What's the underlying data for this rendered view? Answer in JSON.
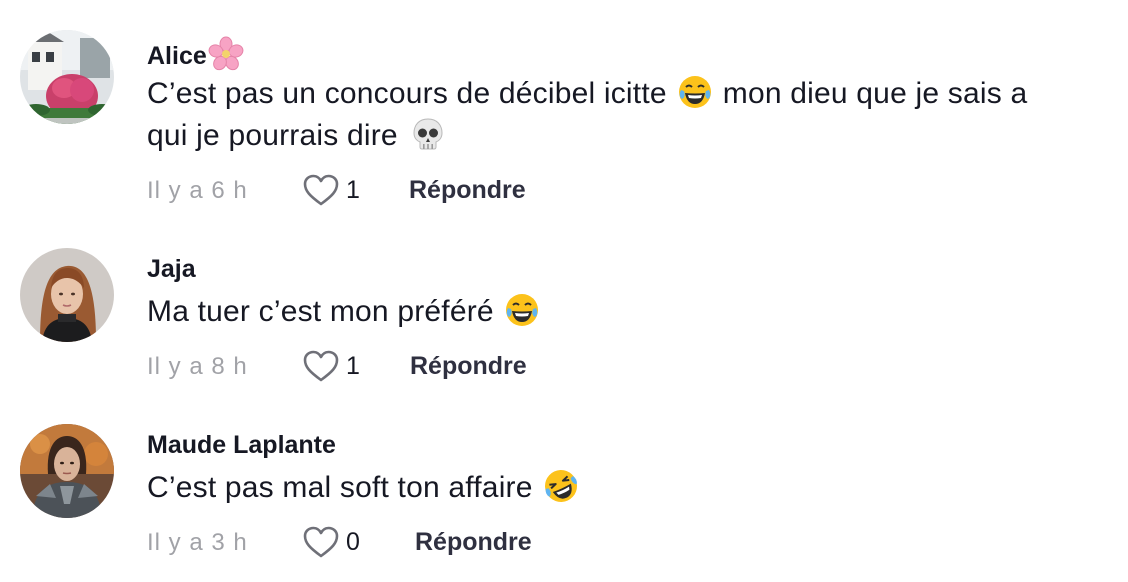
{
  "comments": [
    {
      "username": "Alice",
      "username_emoji": "cherry-blossom",
      "line1_a": "C’est pas un concours de décibel icitte",
      "line1_emoji": "tears-of-joy",
      "line1_b": "mon dieu que je sais a",
      "line2_a": "qui je pourrais dire",
      "line2_emoji": "skull",
      "time": "Il y a 6 h",
      "likes": "1",
      "reply_label": "Répondre"
    },
    {
      "username": "Jaja",
      "text": "Ma tuer c’est mon préféré",
      "text_emoji": "tears-of-joy",
      "time": "Il y a 8 h",
      "likes": "1",
      "reply_label": "Répondre"
    },
    {
      "username": "Maude Laplante",
      "text": "C’est pas mal soft ton affaire",
      "text_emoji": "rolling-on-floor-laughing",
      "time": "Il y a 3 h",
      "likes": "0",
      "reply_label": "Répondre"
    }
  ],
  "colors": {
    "text": "#161823",
    "muted": "#a1a2a7",
    "reply": "#2f3040"
  }
}
